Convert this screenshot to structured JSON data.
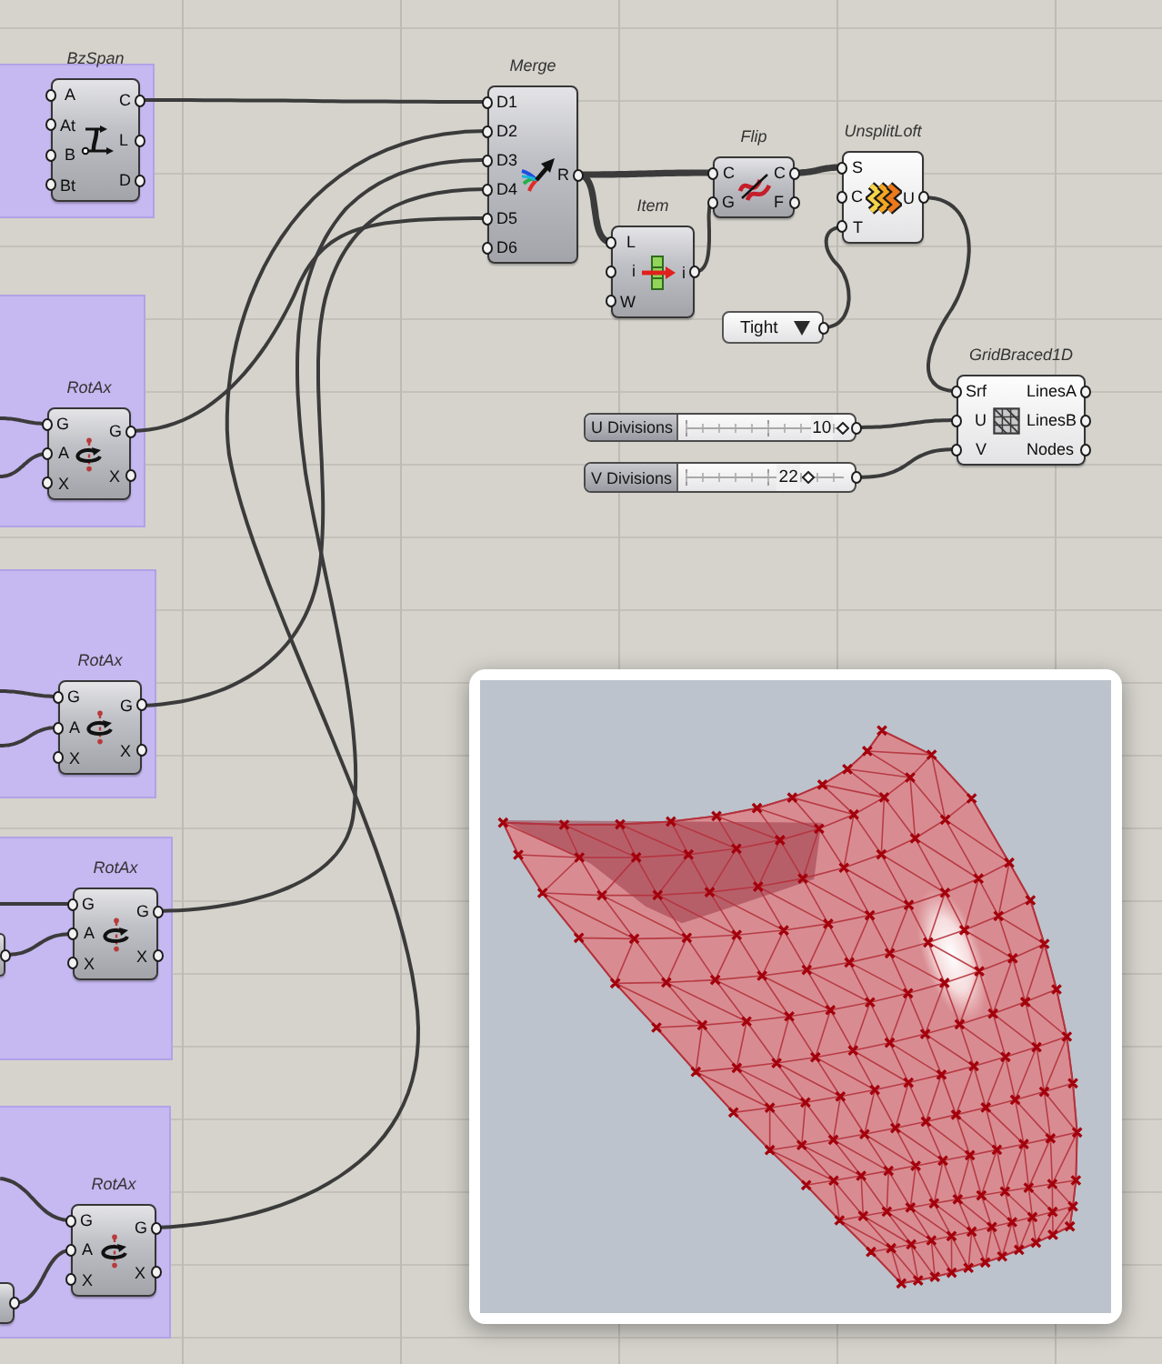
{
  "groups": [
    {
      "components": [
        {
          "kind": "component",
          "title": "BzSpan",
          "inputs": [
            "A",
            "At",
            "B",
            "Bt"
          ],
          "outputs": [
            "C",
            "L",
            "D"
          ]
        }
      ]
    },
    {
      "components": [
        {
          "kind": "component",
          "title": "RotAx",
          "inputs": [
            "G",
            "A",
            "X"
          ],
          "outputs": [
            "G",
            "X"
          ]
        }
      ]
    },
    {
      "components": [
        {
          "kind": "component",
          "title": "RotAx",
          "inputs": [
            "G",
            "A",
            "X"
          ],
          "outputs": [
            "G",
            "X"
          ]
        }
      ]
    },
    {
      "components": [
        {
          "kind": "cutoff"
        },
        {
          "kind": "component",
          "title": "RotAx",
          "inputs": [
            "G",
            "A",
            "X"
          ],
          "outputs": [
            "G",
            "X"
          ]
        }
      ]
    },
    {
      "components": [
        {
          "kind": "cutoff"
        },
        {
          "kind": "component",
          "title": "RotAx",
          "inputs": [
            "G",
            "A",
            "X"
          ],
          "outputs": [
            "G",
            "X"
          ]
        }
      ]
    }
  ],
  "components": [
    {
      "kind": "component",
      "title": "Merge",
      "inputs": [
        "D1",
        "D2",
        "D3",
        "D4",
        "D5",
        "D6"
      ],
      "outputs": [
        "R"
      ]
    },
    {
      "kind": "component",
      "title": "Flip",
      "inputs": [
        "C",
        "G"
      ],
      "outputs": [
        "C",
        "F"
      ]
    },
    {
      "kind": "component",
      "title": "Item",
      "inputs": [
        "L",
        "i",
        "W"
      ],
      "outputs": [
        "i"
      ]
    },
    {
      "kind": "plugin",
      "title": "UnsplitLoft",
      "inputs": [
        "S",
        "C",
        "T"
      ],
      "outputs": [
        "U"
      ]
    },
    {
      "kind": "valuelist",
      "value": "Tight"
    },
    {
      "kind": "plugin",
      "title": "GridBraced1D",
      "inputs": [
        "Srf",
        "U",
        "V"
      ],
      "outputs": [
        "LinesA",
        "LinesB",
        "Nodes"
      ]
    },
    {
      "kind": "slider",
      "label": "U Divisions",
      "value": "10",
      "level": 0.99
    },
    {
      "kind": "slider",
      "label": "V Divisions",
      "value": "22",
      "level": 0.78
    }
  ],
  "preview": {
    "visible": true
  }
}
